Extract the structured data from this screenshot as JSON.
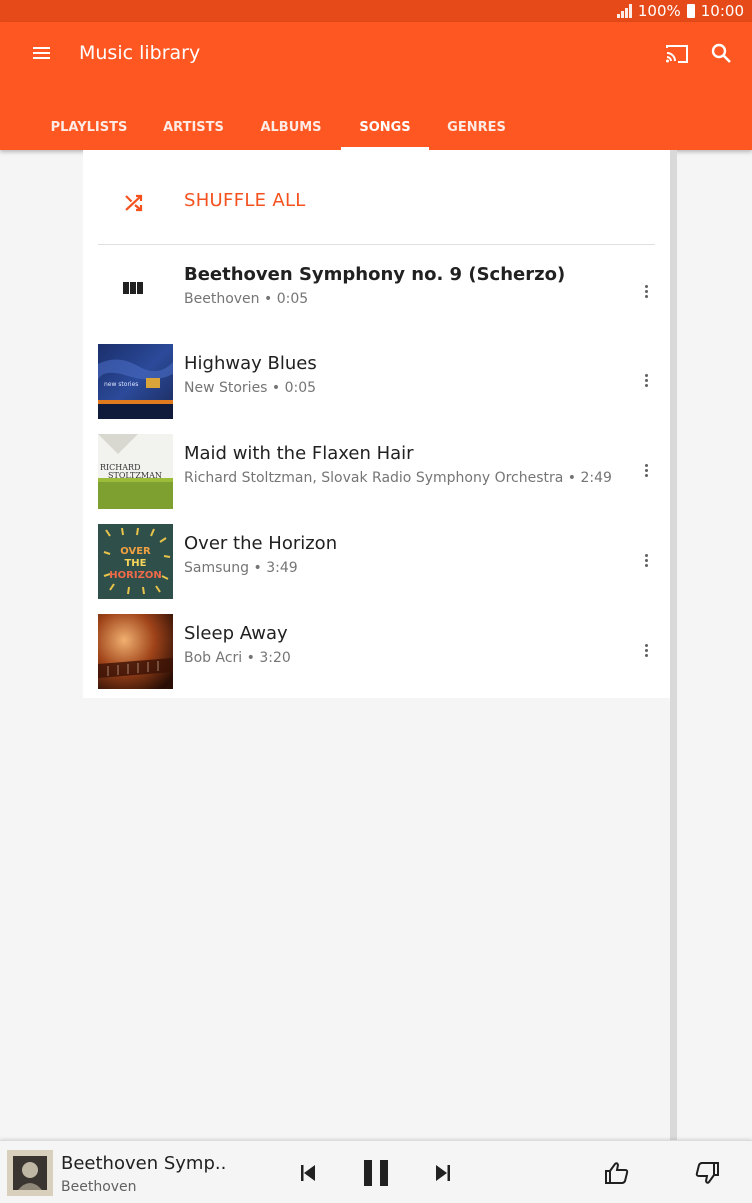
{
  "status": {
    "battery": "100%",
    "time": "10:00"
  },
  "app": {
    "title": "Music library",
    "accent": "#ff5722",
    "statusbar_color": "#e64a19"
  },
  "icons": {
    "menu": "menu-icon",
    "cast": "cast-icon",
    "search": "search-icon",
    "shuffle": "shuffle-icon",
    "more": "more-vert-icon",
    "playing": "equalizer-icon"
  },
  "tabs": [
    {
      "label": "PLAYLISTS",
      "active": false
    },
    {
      "label": "ARTISTS",
      "active": false
    },
    {
      "label": "ALBUMS",
      "active": false
    },
    {
      "label": "SONGS",
      "active": true
    },
    {
      "label": "GENRES",
      "active": false
    }
  ],
  "shuffle": {
    "label": "SHUFFLE ALL"
  },
  "songs": [
    {
      "title": "Beethoven Symphony no. 9 (Scherzo)",
      "subtitle": "Beethoven • 0:05",
      "now_playing": true
    },
    {
      "title": "Highway Blues",
      "subtitle": "New Stories • 0:05",
      "now_playing": false
    },
    {
      "title": "Maid with the Flaxen Hair",
      "subtitle": "Richard Stoltzman, Slovak Radio Symphony Orchestra • 2:49",
      "now_playing": false
    },
    {
      "title": "Over the Horizon",
      "subtitle": "Samsung • 3:49",
      "now_playing": false
    },
    {
      "title": "Sleep Away",
      "subtitle": "Bob Acri • 3:20",
      "now_playing": false
    }
  ],
  "album_art_text": {
    "highway_blues": "new stories",
    "maid": [
      "RICHARD",
      "STOLTZMAN"
    ],
    "horizon": [
      "OVER",
      "THE",
      "HORIZON"
    ]
  },
  "player": {
    "title": "Beethoven Symp..",
    "artist": "Beethoven",
    "controls": [
      "previous-icon",
      "pause-icon",
      "next-icon",
      "thumbs-up-icon",
      "thumbs-down-icon"
    ]
  }
}
